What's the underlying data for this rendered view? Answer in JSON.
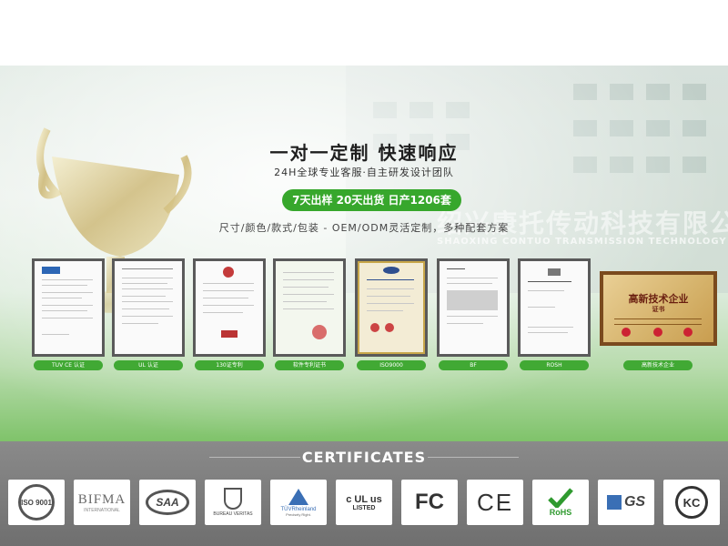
{
  "hero": {
    "headline": "一对一定制 快速响应",
    "subheading": "24H全球专业客服·自主研发设计团队",
    "badge": "7天出样 20天出货 日产1206套",
    "tagline": "尺寸/颜色/款式/包装 - OEM/ODM灵活定制，多种配套方案",
    "company_cn": "绍兴康托传动科技有限公司",
    "company_en": "SHAOXING CONTUO TRANSMISSION TECHNOLOGY CO.,LTD"
  },
  "certificates": [
    {
      "label": "TUV  CE 认证"
    },
    {
      "label": "UL 认证"
    },
    {
      "label": "130证专利"
    },
    {
      "label": "软件专利证书"
    },
    {
      "label": "ISO9000"
    },
    {
      "label": "BF"
    },
    {
      "label": "ROSH"
    },
    {
      "label": "高新技术企业",
      "title": "高新技术企业",
      "subtitle": "证书"
    }
  ],
  "section": {
    "title": "CERTIFICATES"
  },
  "logos": [
    {
      "name": "iso9001",
      "text": "ISO 9001"
    },
    {
      "name": "bifma",
      "text": "BIFMA",
      "sub": "INTERNATIONAL"
    },
    {
      "name": "saa",
      "text": "SAA"
    },
    {
      "name": "bureau-veritas",
      "text": "BUREAU VERITAS"
    },
    {
      "name": "tuv-rheinland",
      "text": "TÜVRheinland",
      "sub": "Precisely Right."
    },
    {
      "name": "cul-us",
      "text": "c UL us",
      "sub": "LISTED"
    },
    {
      "name": "fcc",
      "text": "FC"
    },
    {
      "name": "ce",
      "text": "CE"
    },
    {
      "name": "rohs",
      "text": "RoHS"
    },
    {
      "name": "gs",
      "text": "GS"
    },
    {
      "name": "kc",
      "text": "KC"
    }
  ],
  "colors": {
    "accent_green": "#37a72c",
    "section_gray": "#7a7a7a"
  }
}
